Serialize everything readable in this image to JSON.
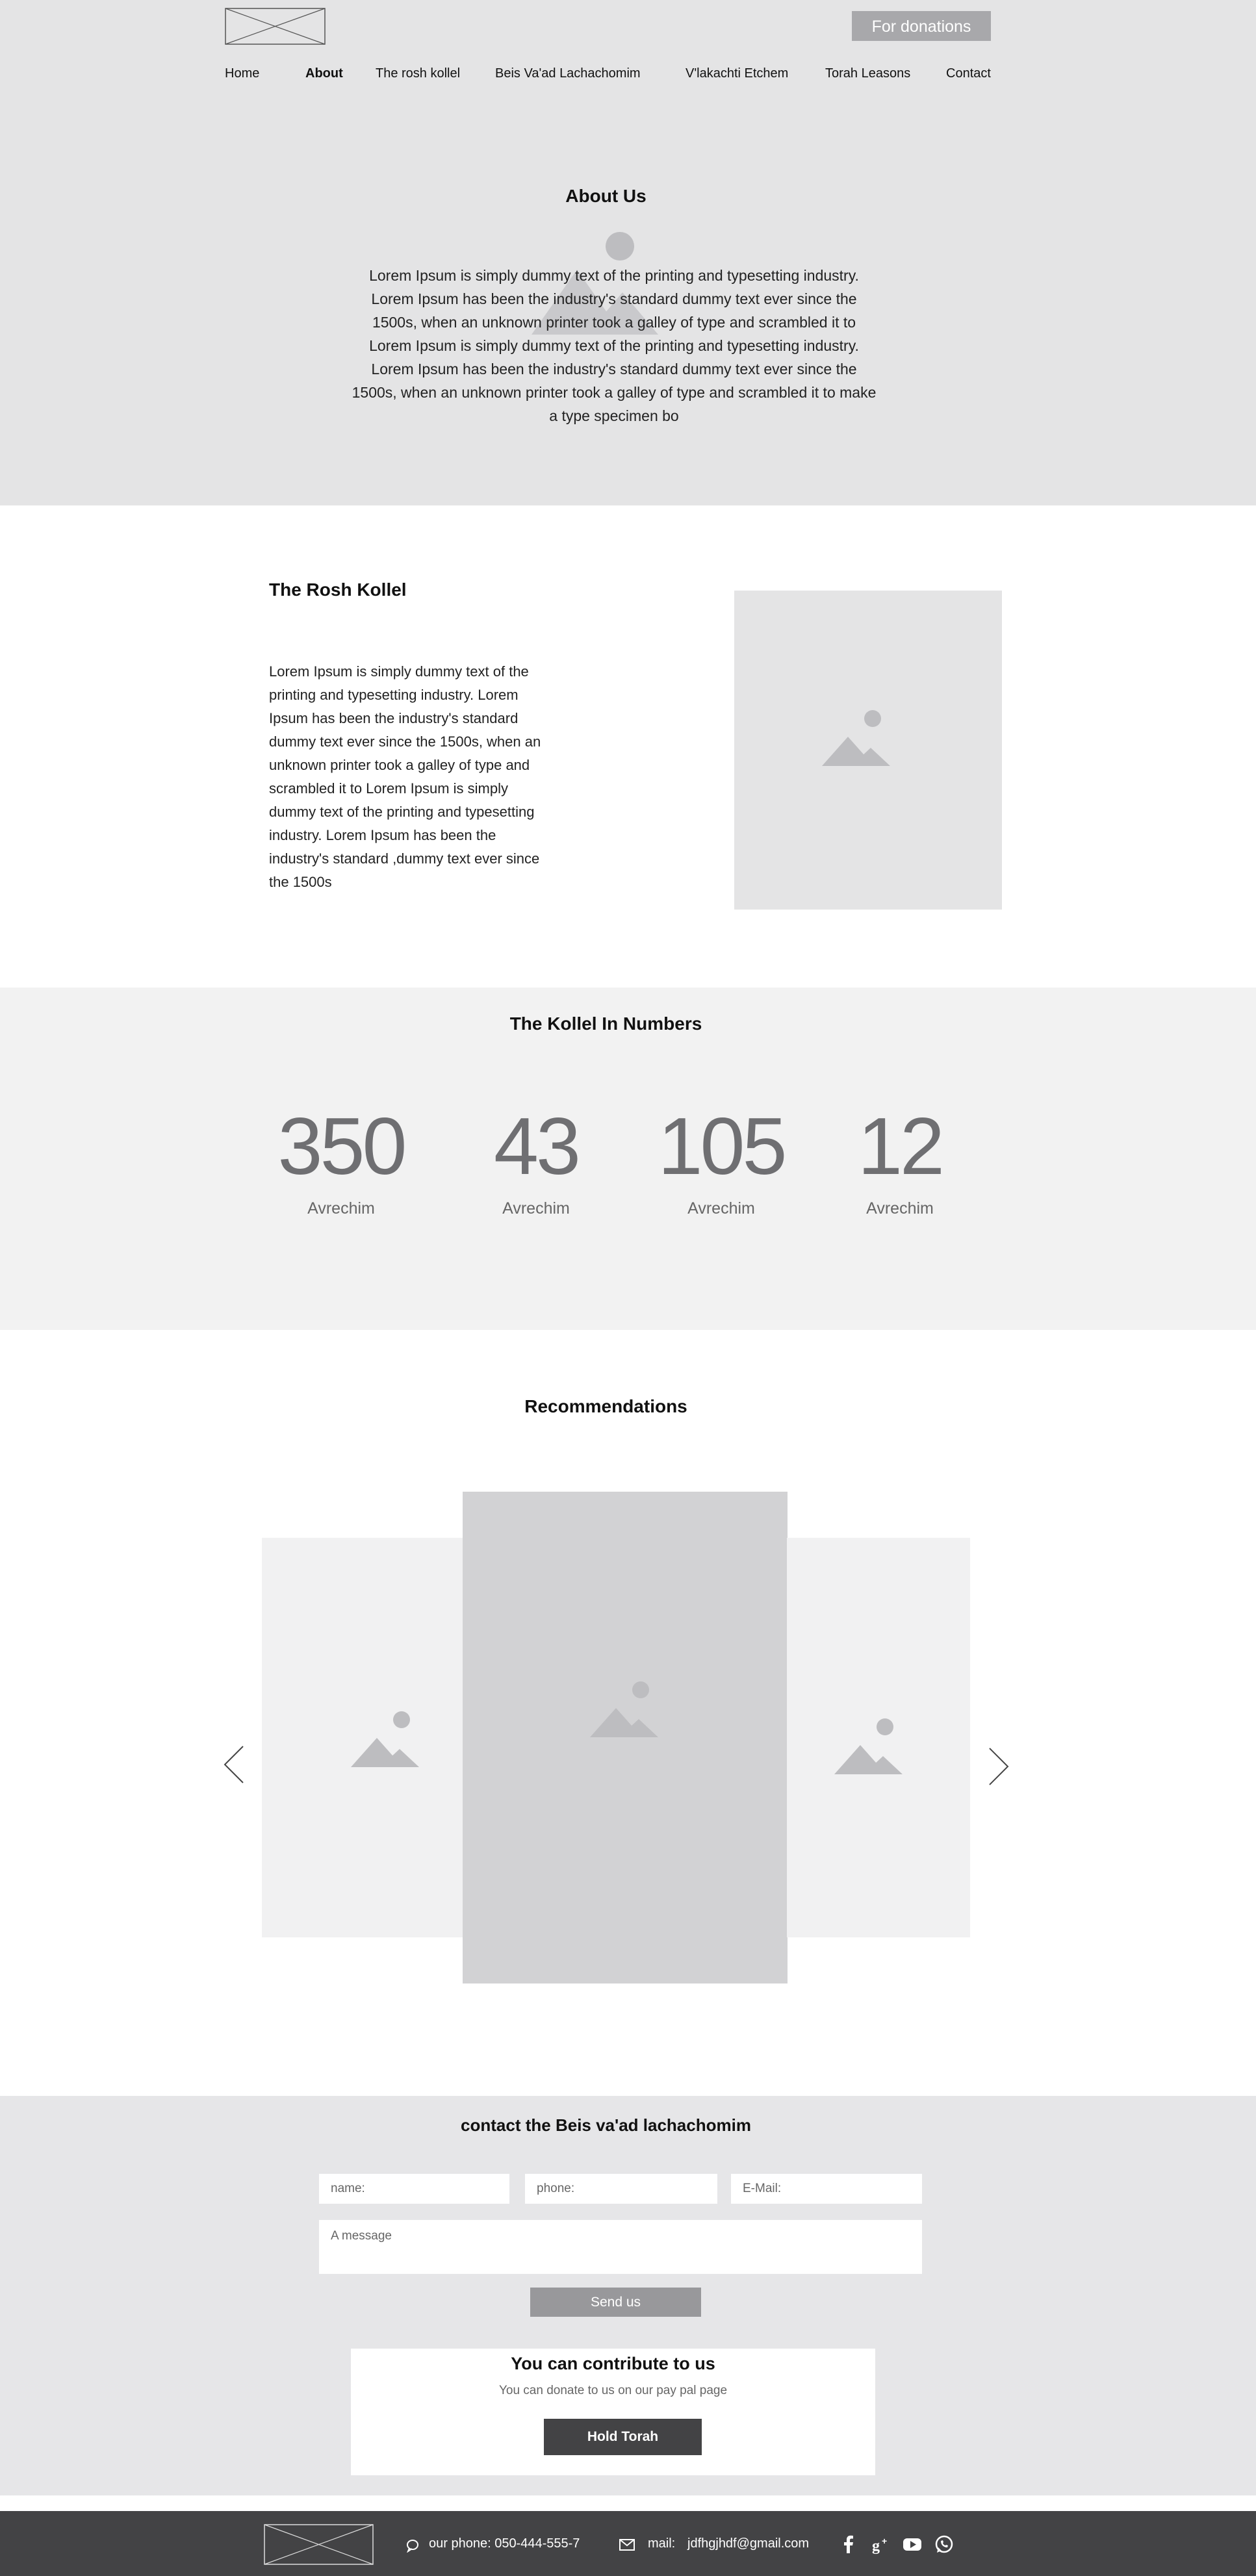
{
  "header": {
    "donate_label": "For donations",
    "nav": [
      "Home",
      "About",
      "The rosh kollel",
      "Beis Va'ad Lachachomim",
      "V'lakachti Etchem",
      "Torah Leasons",
      "Contact"
    ],
    "active_nav": "About"
  },
  "about": {
    "title": "About Us",
    "text": "Lorem Ipsum is simply dummy text of the printing and typesetting industry. Lorem Ipsum has been the industry's standard dummy text ever since the 1500s, when an unknown printer took a galley of type and scrambled it to Lorem Ipsum is simply dummy text of the printing and typesetting industry. Lorem Ipsum has been the industry's standard dummy text ever since the 1500s, when an unknown printer took a galley of type and scrambled it to make a type specimen bo"
  },
  "rosh_kollel": {
    "title": "The Rosh Kollel",
    "text": "Lorem Ipsum is simply dummy text of the printing and typesetting industry. Lorem Ipsum has been the industry's standard dummy text ever since the 1500s, when an unknown printer took a galley of type and scrambled it to Lorem Ipsum is simply dummy text of the printing and typesetting industry. Lorem Ipsum has been the industry's standard ,dummy text ever since the 1500s"
  },
  "numbers": {
    "title": "The Kollel In Numbers",
    "stats": [
      {
        "value": "350",
        "label": "Avrechim"
      },
      {
        "value": "43",
        "label": "Avrechim"
      },
      {
        "value": "105",
        "label": "Avrechim"
      },
      {
        "value": "12",
        "label": "Avrechim"
      }
    ]
  },
  "recommendations": {
    "title": "Recommendations"
  },
  "contact": {
    "title": "contact the Beis va'ad lachachomim",
    "name_placeholder": "name:",
    "phone_placeholder": "phone:",
    "email_placeholder": "E-Mail:",
    "message_placeholder": "A message",
    "send_label": "Send us"
  },
  "contribute": {
    "title": "You can contribute to us",
    "subtitle": "You can donate to us on our pay pal page",
    "button_label": "Hold Torah"
  },
  "footer": {
    "phone_text": "our phone: 050-444-555-7",
    "mail_label": "mail:",
    "mail_value": "jdfhgjhdf@gmail.com",
    "social_icons": [
      "facebook-icon",
      "google-plus-icon",
      "youtube-icon",
      "whatsapp-icon"
    ]
  },
  "colors": {
    "hero_bg": "#e4e4e5",
    "numbers_bg": "#f2f2f2",
    "footer_bg": "#434345",
    "accent_button": "#a8a8ab"
  }
}
